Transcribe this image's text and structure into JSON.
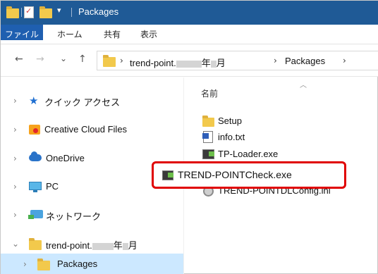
{
  "window": {
    "title": "Packages"
  },
  "ribbon": {
    "tabs": [
      "ファイル",
      "ホーム",
      "共有",
      "表示"
    ]
  },
  "address": {
    "breadcrumb": [
      "trend-point.",
      "年",
      "月",
      "Packages"
    ],
    "separator": "›"
  },
  "nav_buttons": {
    "back": "←",
    "forward": "→",
    "recent": "⌄",
    "up": "↑"
  },
  "navpane": {
    "items": [
      {
        "label": "クイック アクセス",
        "icon": "star-icon",
        "expanded": false
      },
      {
        "label": "Creative Cloud Files",
        "icon": "creative-cloud-icon",
        "expanded": false
      },
      {
        "label": "OneDrive",
        "icon": "onedrive-cloud-icon",
        "expanded": false
      },
      {
        "label": "PC",
        "icon": "pc-icon",
        "expanded": false
      },
      {
        "label": "ネットワーク",
        "icon": "network-icon",
        "expanded": false
      },
      {
        "label_prefix": "trend-point.",
        "label_year": "年",
        "label_month": "月",
        "icon": "folder-icon",
        "expanded": true
      },
      {
        "label": "Packages",
        "icon": "folder-icon",
        "selected": true
      }
    ]
  },
  "content": {
    "column_header": "名前",
    "files": [
      {
        "name": "Setup",
        "icon": "folder-icon"
      },
      {
        "name": "info.txt",
        "icon": "text-file-icon"
      },
      {
        "name": "TP-Loader.exe",
        "icon": "exe-icon"
      },
      {
        "name": "TREND-POINTCheck.exe",
        "icon": "exe-icon",
        "highlighted": true
      },
      {
        "name": "TREND-POINTDLConfig.ini",
        "icon": "ini-file-icon"
      }
    ]
  },
  "colors": {
    "titlebar": "#1f5a96",
    "file_tab": "#1f5fb0",
    "selection": "#cce8ff",
    "highlight_border": "#e00000"
  }
}
